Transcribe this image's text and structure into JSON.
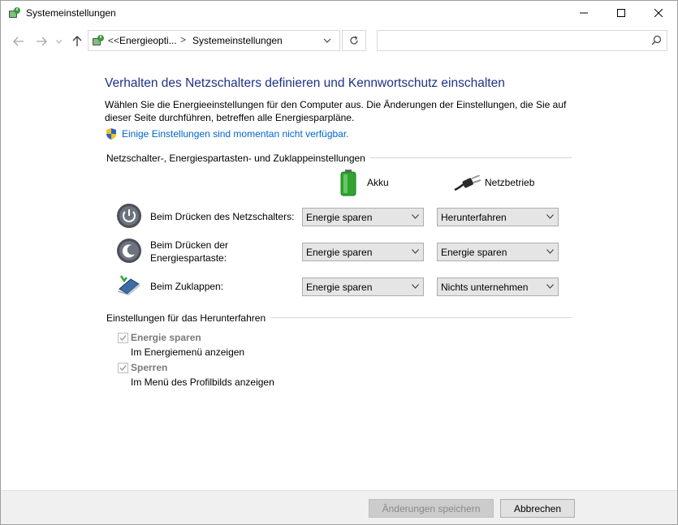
{
  "window": {
    "title": "Systemeinstellungen"
  },
  "navbar": {
    "crumb_prefix": "<<",
    "crumb_1": "Energieopti...",
    "crumb_sep": ">",
    "crumb_2": "Systemeinstellungen",
    "search_placeholder": ""
  },
  "main": {
    "heading": "Verhalten des Netzschalters definieren und Kennwortschutz einschalten",
    "description": "Wählen Sie die Energieeinstellungen für den Computer aus. Die Änderungen der Einstellungen, die Sie auf dieser Seite durchführen, betreffen alle Energiesparpläne.",
    "unavailable_link": "Einige Einstellungen sind momentan nicht verfügbar."
  },
  "power_section": {
    "label": "Netzschalter-, Energiespartasten- und Zuklappeinstellungen",
    "col_battery": "Akku",
    "col_power": "Netzbetrieb",
    "rows": [
      {
        "label": "Beim Drücken des Netzschalters:",
        "battery": "Energie sparen",
        "power": "Herunterfahren"
      },
      {
        "label_line1": "Beim Drücken der",
        "label_line2": "Energiespartaste:",
        "battery": "Energie sparen",
        "power": "Energie sparen"
      },
      {
        "label": "Beim Zuklappen:",
        "battery": "Energie sparen",
        "power": "Nichts unternehmen"
      }
    ]
  },
  "shutdown_section": {
    "label": "Einstellungen für das Herunterfahren",
    "items": [
      {
        "title": "Energie sparen",
        "subtitle": "Im Energiemenü anzeigen",
        "checked": true
      },
      {
        "title": "Sperren",
        "subtitle": "Im Menü des Profilbilds anzeigen",
        "checked": true
      }
    ]
  },
  "footer": {
    "save_label": "Änderungen speichern",
    "cancel_label": "Abbrechen"
  },
  "colors": {
    "heading": "#1e3287",
    "link": "#0066cc",
    "battery_green": "#2fa52f"
  }
}
